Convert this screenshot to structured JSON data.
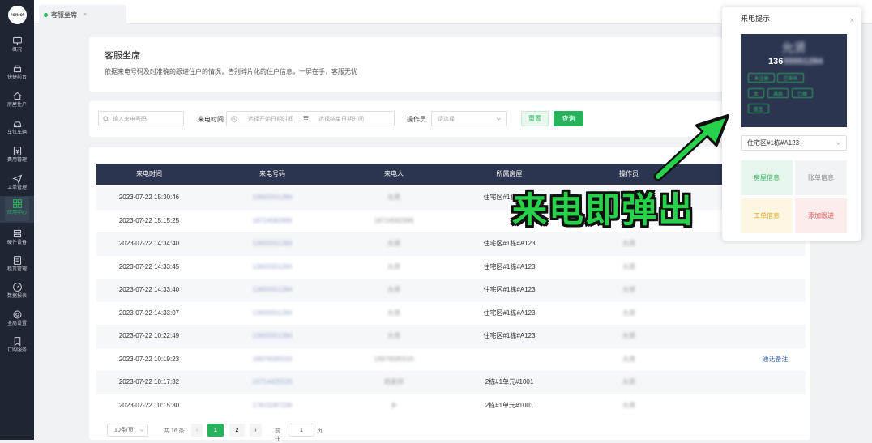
{
  "app": {
    "logo": "ronlot"
  },
  "sidebar": {
    "items": [
      {
        "label": "概况",
        "icon": "monitor-icon"
      },
      {
        "label": "快捷前台",
        "icon": "desk-icon"
      },
      {
        "label": "房屋住户",
        "icon": "home-icon"
      },
      {
        "label": "车位车辆",
        "icon": "car-icon"
      },
      {
        "label": "费用管理",
        "icon": "bill-icon"
      },
      {
        "label": "工单管理",
        "icon": "send-icon"
      },
      {
        "label": "应用中心",
        "icon": "grid-icon",
        "active": true
      },
      {
        "label": "硬件设备",
        "icon": "server-icon"
      },
      {
        "label": "租赁管理",
        "icon": "document-icon"
      },
      {
        "label": "数据报表",
        "icon": "gauge-icon"
      },
      {
        "label": "全局设置",
        "icon": "settings-icon"
      },
      {
        "label": "订购服务",
        "icon": "bookmark-icon"
      }
    ]
  },
  "tabs": [
    {
      "label": "客服坐席",
      "close": "×"
    }
  ],
  "header": {
    "title": "客服坐席",
    "description": "依据来电号码及时准确的跟进住户的情况，告别碎片化的住户信息，一屏在手，客服无忧"
  },
  "filters": {
    "phone_placeholder": "输入来电号码",
    "time_label": "来电时间",
    "start_placeholder": "选择开始日期时间",
    "range_sep": "至",
    "end_placeholder": "选择结束日期时间",
    "operator_label": "操作员",
    "operator_placeholder": "请选择",
    "reset_label": "重置",
    "query_label": "查询"
  },
  "table": {
    "columns": [
      "来电时间",
      "来电号码",
      "来电人",
      "所属房屋",
      "操作员"
    ],
    "rows": [
      {
        "time": "2023-07-22 15:30:46",
        "phone": "13655551284",
        "caller": "允贤",
        "house": "住宅区#1栋#A123",
        "operator": "",
        "action": ""
      },
      {
        "time": "2023-07-22 15:15:25",
        "phone": "18724582999",
        "caller": "18724582999",
        "house": "",
        "operator": "",
        "action": ""
      },
      {
        "time": "2023-07-22 14:34:40",
        "phone": "13655551284",
        "caller": "允贤",
        "house": "住宅区#1栋#A123",
        "operator": "允贤",
        "action": ""
      },
      {
        "time": "2023-07-22 14:33:45",
        "phone": "13655551284",
        "caller": "允贤",
        "house": "住宅区#1栋#A123",
        "operator": "允贤",
        "action": ""
      },
      {
        "time": "2023-07-22 14:33:40",
        "phone": "13655551284",
        "caller": "允贤",
        "house": "住宅区#1栋#A123",
        "operator": "允贤",
        "action": ""
      },
      {
        "time": "2023-07-22 14:33:07",
        "phone": "13655551284",
        "caller": "允贤",
        "house": "住宅区#1栋#A123",
        "operator": "允贤",
        "action": ""
      },
      {
        "time": "2023-07-22 10:22:49",
        "phone": "13655551284",
        "caller": "允贤",
        "house": "住宅区#1栋#A123",
        "operator": "允贤",
        "action": ""
      },
      {
        "time": "2023-07-22 10:19:23",
        "phone": "18976585533",
        "caller": "18976585533",
        "house": "",
        "operator": "允贤",
        "action": "通话备注"
      },
      {
        "time": "2023-07-22 10:17:32",
        "phone": "15714425526",
        "caller": "杨家祥",
        "house": "2栋#1单元#1001",
        "operator": "允贤",
        "action": ""
      },
      {
        "time": "2023-07-22 10:15:30",
        "phone": "17815287236",
        "caller": "乡",
        "house": "2栋#1单元#1001",
        "operator": "允贤",
        "action": ""
      }
    ]
  },
  "pagination": {
    "page_size": "10条/页",
    "total": "共 16 条",
    "prev": "‹",
    "pages": [
      "1",
      "2"
    ],
    "next": "›",
    "goto_label": "前往",
    "goto_value": "1",
    "goto_unit": "页"
  },
  "popup": {
    "title": "来电提示",
    "close": "×",
    "caller_name": "允贤",
    "phone_prefix": "136",
    "phone_rest": "55551284",
    "tags": [
      "未注册",
      "已审核",
      "女",
      "满族",
      "已婚",
      "医生"
    ],
    "house_value": "住宅区#1栋#A123",
    "actions": {
      "house": "房屋信息",
      "bill": "账单信息",
      "workorder": "工单信息",
      "follow": "添加跟进"
    }
  },
  "overlay": {
    "text": "来电即弹出"
  },
  "colors": {
    "accent": "#27b35c",
    "sidebar": "#1f2532",
    "header_row": "#2c3550",
    "overlay": "#27d24a"
  }
}
